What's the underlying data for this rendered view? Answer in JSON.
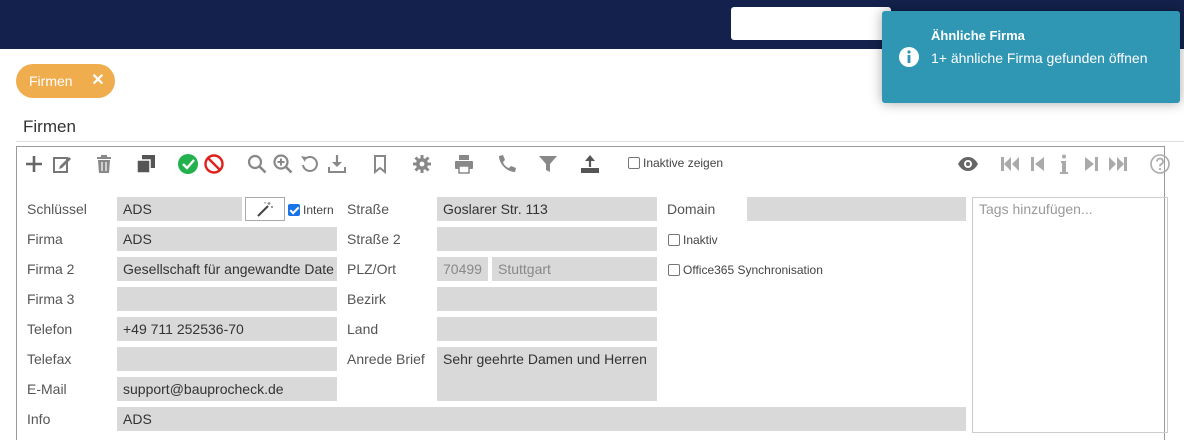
{
  "top_search": {
    "value": ""
  },
  "toast": {
    "title": "Ähnliche Firma",
    "message": "1+ ähnliche Firma gefunden öffnen",
    "color": "#2f96b4"
  },
  "tab": {
    "label": "Firmen",
    "close_glyph": "✕",
    "color": "#f0ad4e"
  },
  "page_title": "Firmen",
  "toolbar": {
    "inactive_label": "Inaktive zeigen",
    "inactive_checked": false,
    "icons": [
      "plus-icon",
      "edit-icon",
      "trash-icon",
      "copy-icon",
      "check-circle-icon",
      "cancel-circle-icon",
      "search-icon",
      "zoom-in-icon",
      "undo-icon",
      "download-icon",
      "bookmark-icon",
      "gear-icon",
      "print-icon",
      "phone-icon",
      "filter-icon",
      "upload-icon",
      "eye-icon",
      "first-icon",
      "prev-icon",
      "info-icon",
      "next-icon",
      "last-icon",
      "help-icon"
    ]
  },
  "form": {
    "left": [
      {
        "label": "Schlüssel",
        "value": "ADS"
      },
      {
        "label": "Firma",
        "value": "ADS"
      },
      {
        "label": "Firma 2",
        "value": "Gesellschaft für angewandte Date"
      },
      {
        "label": "Firma 3",
        "value": ""
      },
      {
        "label": "Telefon",
        "value": "+49 711 252536-70"
      },
      {
        "label": "Telefax",
        "value": ""
      },
      {
        "label": "E-Mail",
        "value": "support@bauprocheck.de"
      },
      {
        "label": "Info",
        "value": "ADS"
      }
    ],
    "intern_label": "Intern",
    "intern_checked": true,
    "middle": [
      {
        "label": "Straße",
        "value": "Goslarer Str. 113"
      },
      {
        "label": "Straße 2",
        "value": ""
      },
      {
        "label": "PLZ/Ort",
        "plz": "70499",
        "ort": "Stuttgart"
      },
      {
        "label": "Bezirk",
        "value": ""
      },
      {
        "label": "Land",
        "value": ""
      },
      {
        "label": "Anrede Brief",
        "value": "Sehr geehrte Damen und Herren"
      }
    ],
    "right": {
      "domain_label": "Domain",
      "domain_value": "",
      "inaktiv_label": "Inaktiv",
      "office_label": "Office365 Synchronisation"
    },
    "tags_placeholder": "Tags hinzufügen..."
  }
}
